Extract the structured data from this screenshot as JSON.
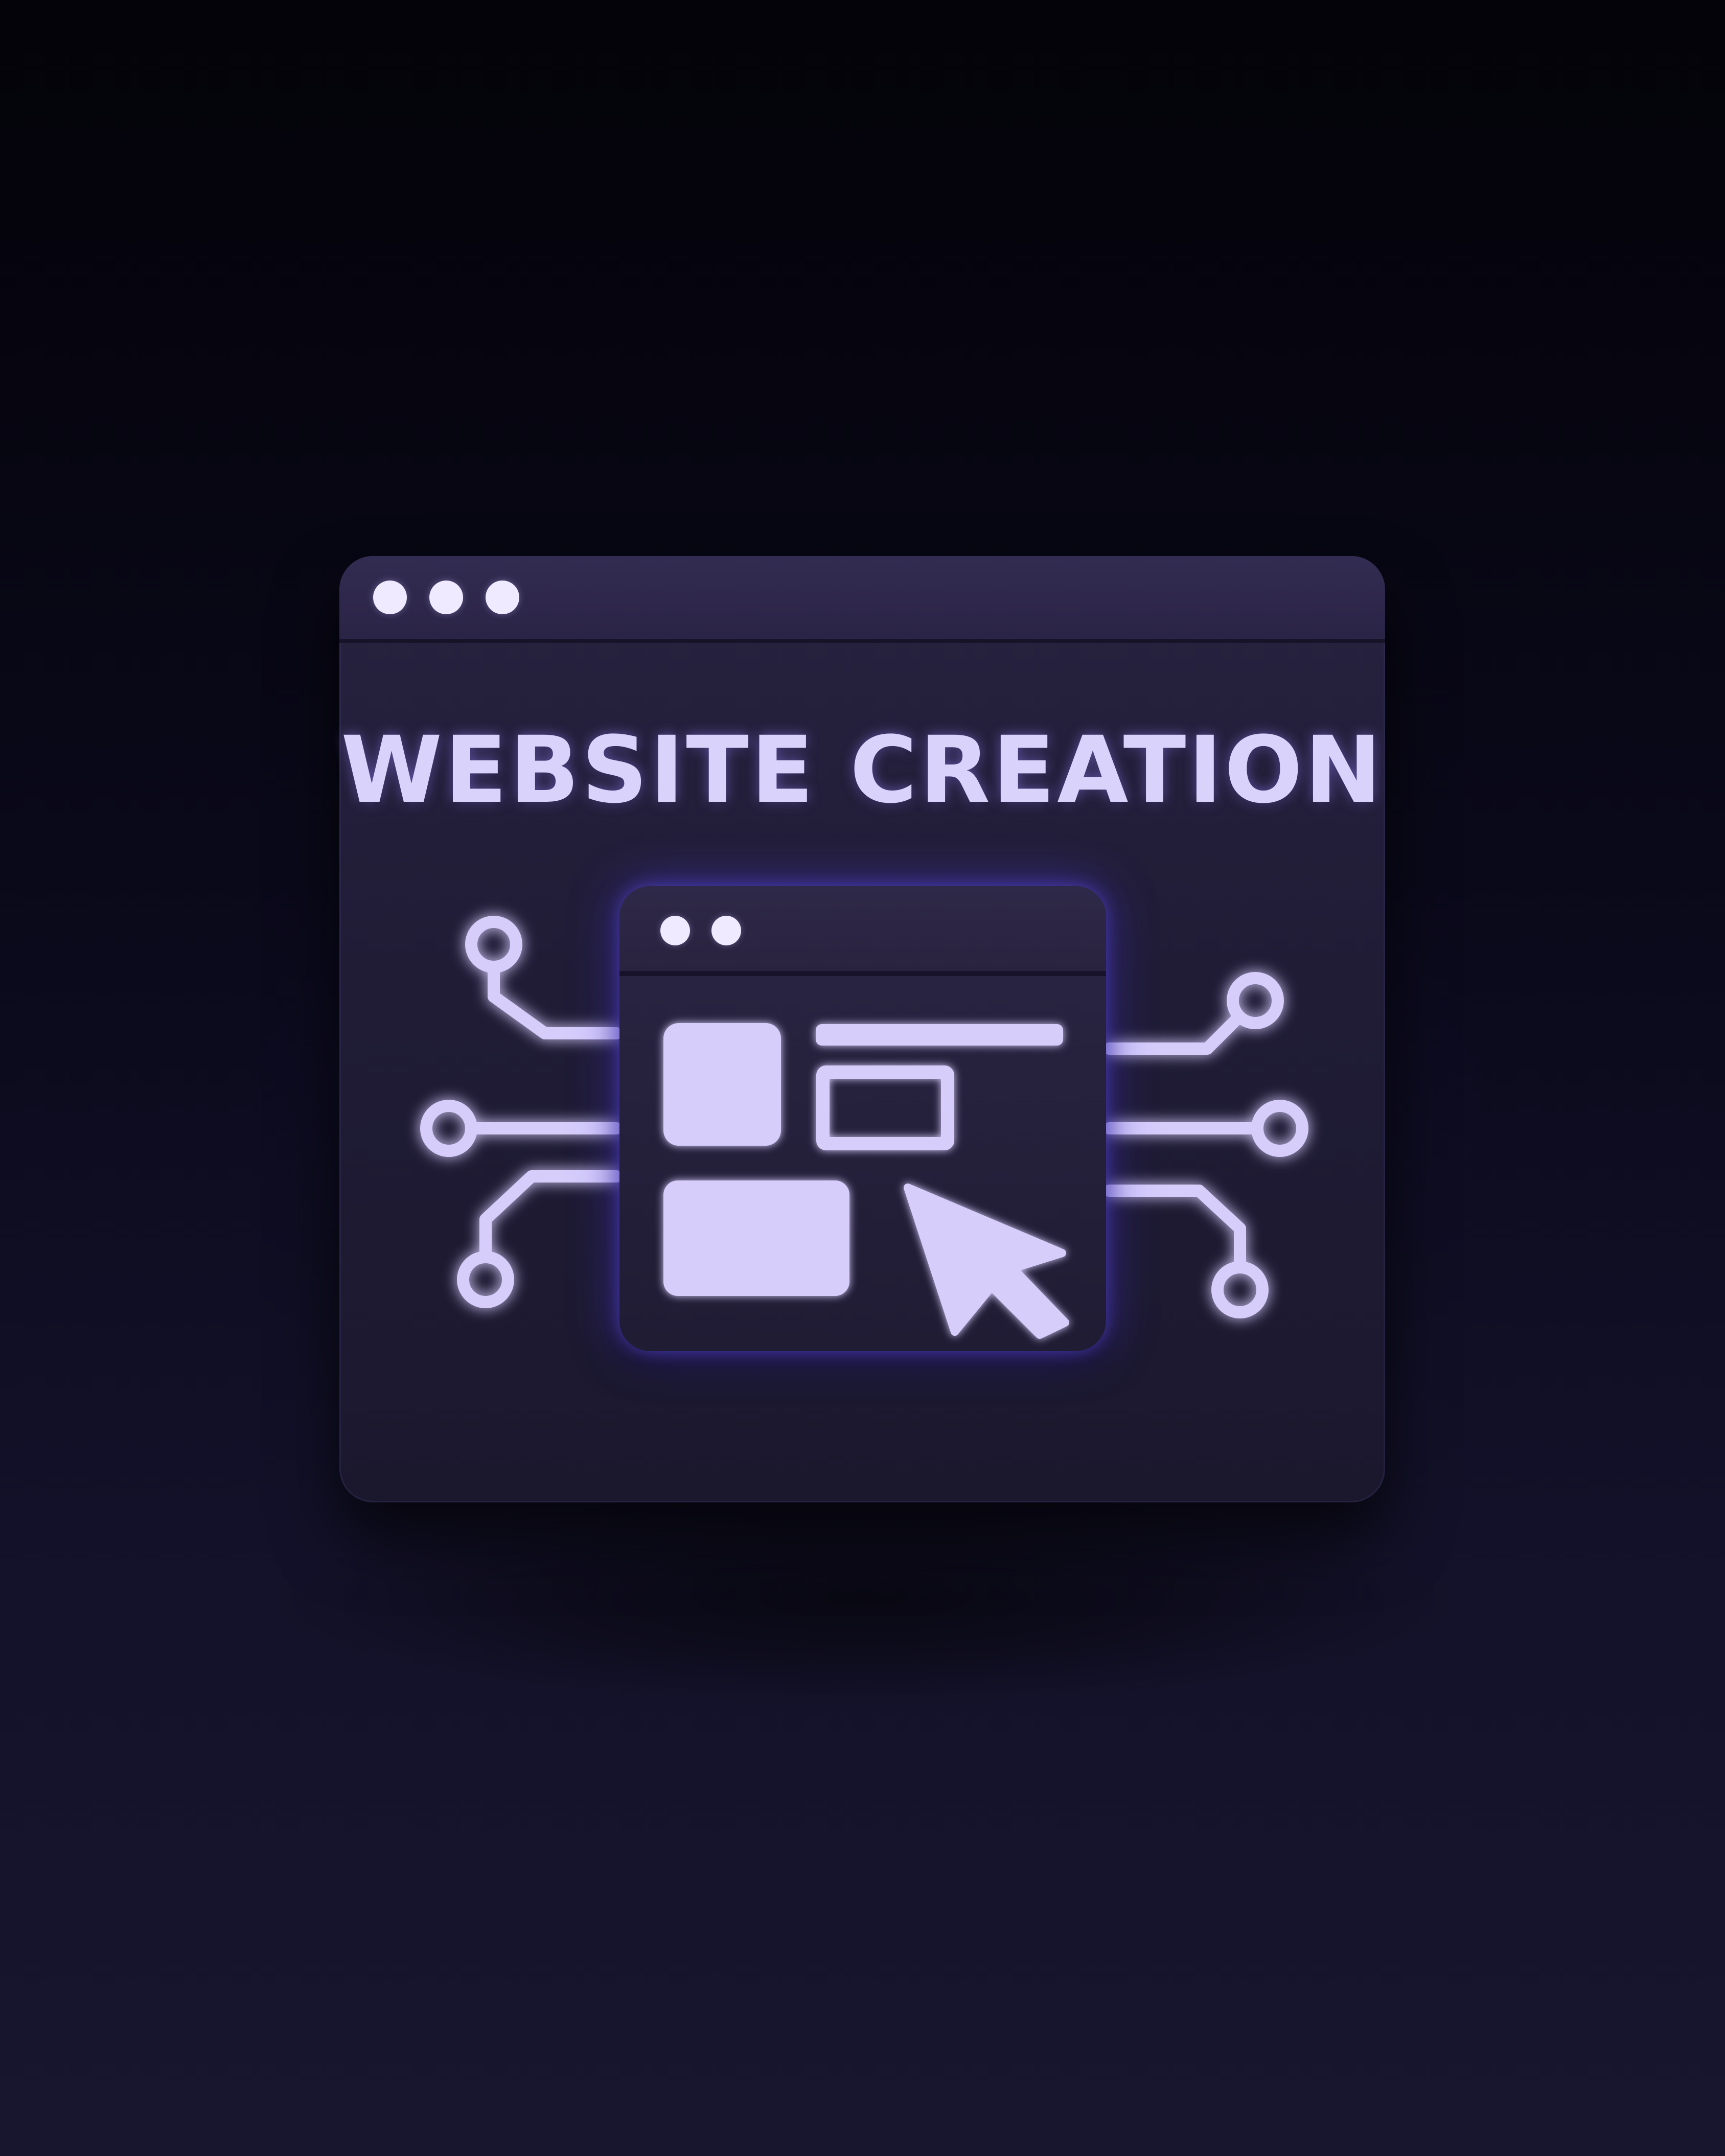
{
  "headline": "WEBSITE CREATION",
  "colors": {
    "background": "#07060f",
    "panel": "#221d38",
    "accent_glow": "#5a46ff",
    "line": "#d6cdfb"
  },
  "icons": {
    "window_controls": "three-dots-icon",
    "inner_window_controls": "two-dots-icon",
    "layout": "layout-blocks-icon",
    "cursor": "mouse-pointer-icon",
    "circuit": "circuit-connector-icon"
  }
}
